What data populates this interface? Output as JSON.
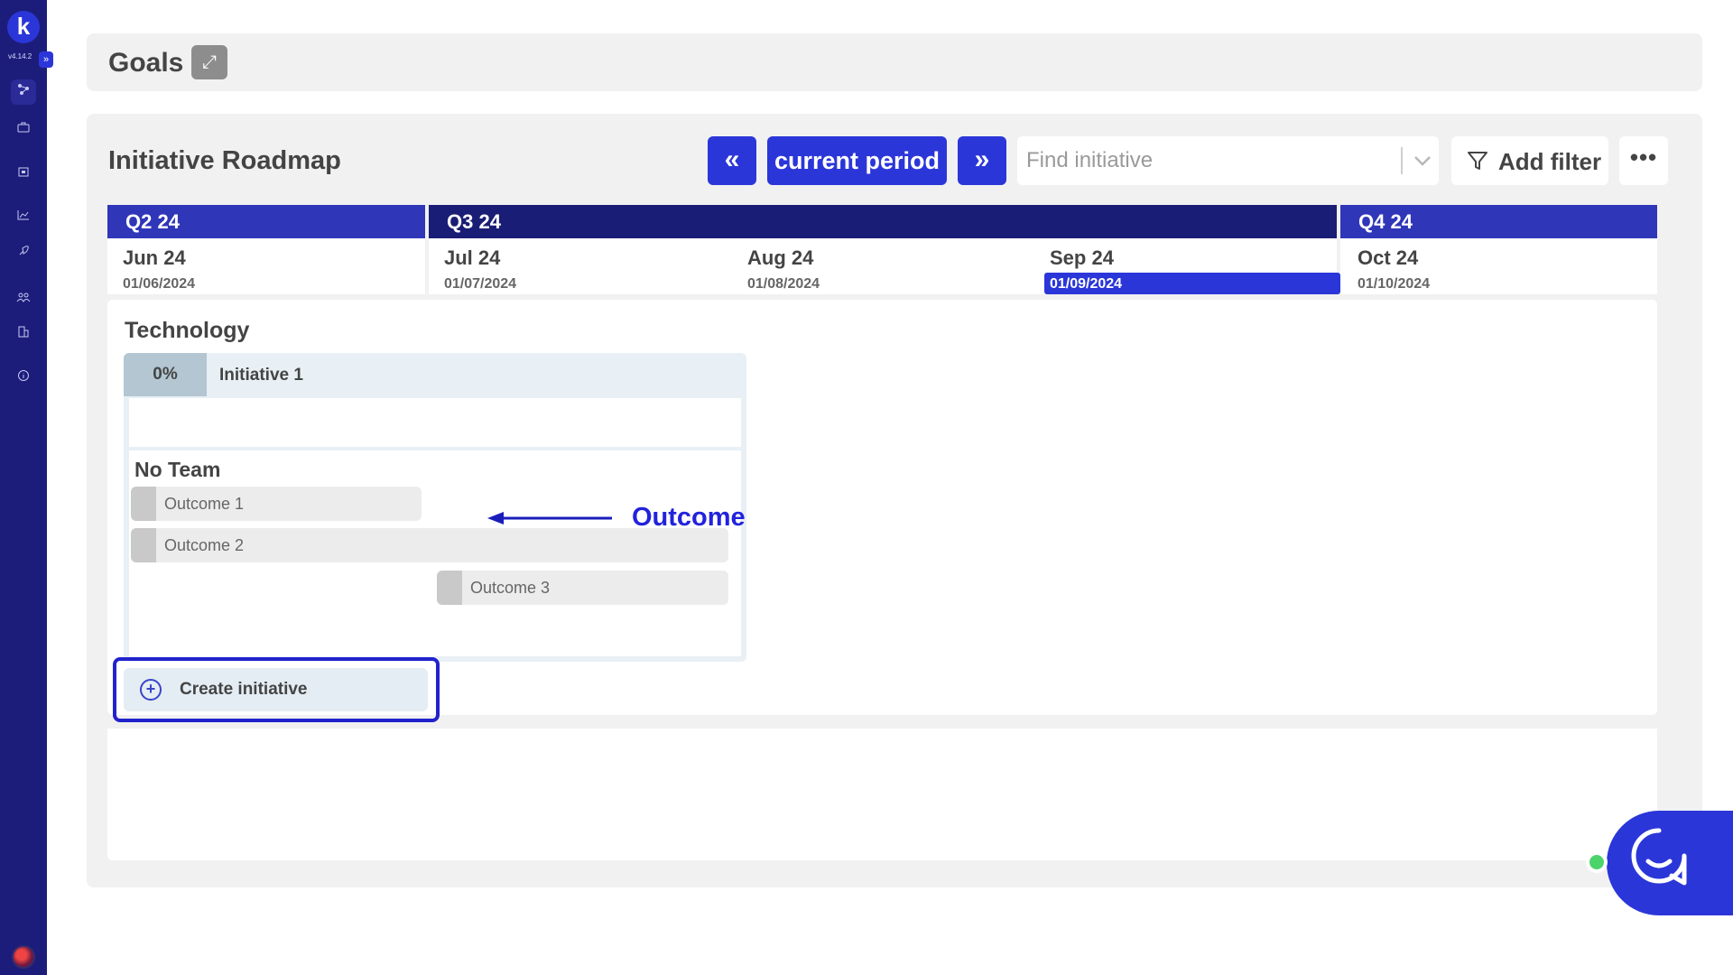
{
  "app": {
    "logo_letter": "k",
    "version": "v4.14.2",
    "expand_glyph": "»",
    "nav_icons": [
      "network-icon",
      "briefcase-icon",
      "calendar-icon",
      "chart-icon",
      "rocket-icon",
      "team-icon",
      "building-icon",
      "info-icon"
    ]
  },
  "goals": {
    "title": "Goals",
    "expand_glyph": "⤢"
  },
  "roadmap": {
    "title": "Initiative Roadmap",
    "prev_glyph": "«",
    "current_period_label": "current period",
    "next_glyph": "»",
    "search_placeholder": "Find initiative",
    "chevron_glyph": "⌄",
    "add_filter_label": "Add filter",
    "more_glyph": "•••",
    "filter_dot_color": "#f45151"
  },
  "timeline": {
    "quarters": [
      "Q2 24",
      "Q3 24",
      "Q4 24"
    ],
    "months": [
      {
        "label": "Jun 24",
        "date": "01/06/2024"
      },
      {
        "label": "Jul 24",
        "date": "01/07/2024"
      },
      {
        "label": "Aug 24",
        "date": "01/08/2024"
      },
      {
        "label": "Sep 24",
        "date": "01/09/2024",
        "current": true
      },
      {
        "label": "Oct 24",
        "date": "01/10/2024"
      }
    ]
  },
  "board": {
    "team": "Technology",
    "initiative": {
      "progress": "0%",
      "name": "Initiative 1"
    },
    "group": "No Team",
    "outcomes": [
      "Outcome 1",
      "Outcome 2",
      "Outcome 3"
    ],
    "annotation": "Outcome",
    "create_label": "Create initiative",
    "create_glyph": "+"
  },
  "colors": {
    "accent": "#2b36d9",
    "rail": "#1c1d7a",
    "annotation": "#2222dd",
    "status_online": "#4cd36a"
  }
}
